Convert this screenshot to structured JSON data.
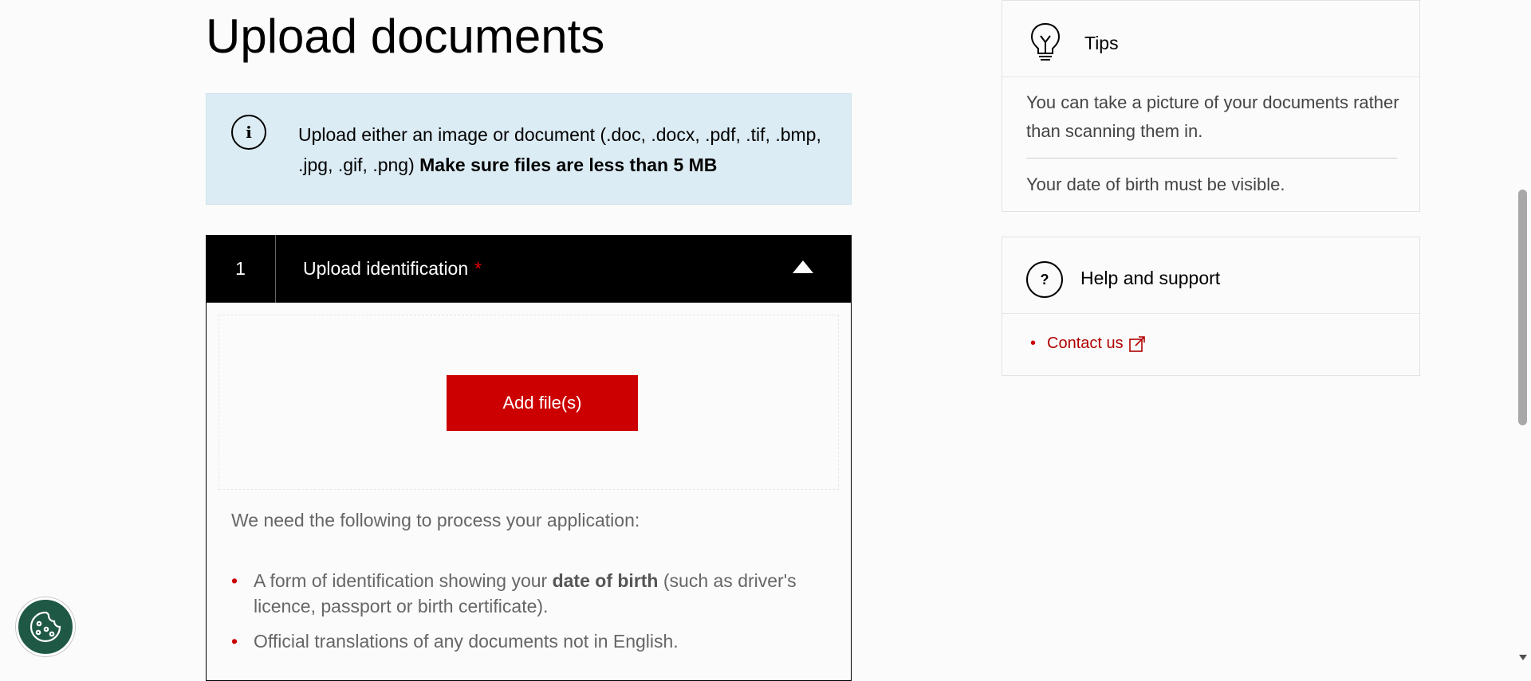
{
  "page": {
    "title": "Upload documents"
  },
  "info": {
    "text": "Upload either an image or document (.doc, .docx, .pdf, .tif, .bmp, .jpg, .gif, .png)",
    "bold_text": "Make sure files are less than 5 MB",
    "icon": "info-icon"
  },
  "section": {
    "number": "1",
    "title": "Upload identification",
    "required_mark": "*",
    "add_button": "Add file(s)",
    "intro": "We need the following to process your application:",
    "items": [
      {
        "before": "A form of identification showing your ",
        "bold": "date of birth",
        "after": " (such as driver's licence, passport or birth certificate)."
      },
      {
        "before": "Official translations of any documents not in English.",
        "bold": "",
        "after": ""
      }
    ]
  },
  "tips": {
    "title": "Tips",
    "icon": "lightbulb-icon",
    "items": [
      "You can take a picture of your documents rather than scanning them in.",
      "Your date of birth must be visible."
    ]
  },
  "help": {
    "title": "Help and support",
    "icon": "question-icon",
    "links": [
      {
        "label": "Contact us",
        "icon": "external-link-icon"
      }
    ]
  },
  "cookie": {
    "icon": "cookie-icon"
  },
  "colors": {
    "accent_red": "#cc0000",
    "info_bg": "#dcecf4",
    "header_bg": "#000000",
    "cookie_bg": "#1f5945"
  }
}
